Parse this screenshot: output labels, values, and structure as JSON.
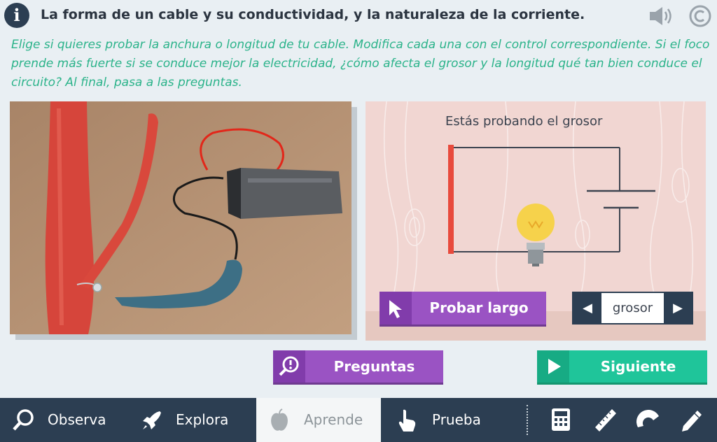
{
  "header": {
    "title": "La forma de un cable y su conductividad, y la naturaleza de la corriente.",
    "info_icon": "info-icon",
    "sound_icon": "speaker-icon",
    "copyright_icon": "copyright-icon"
  },
  "instructions": "Elige si quieres probar la anchura o longitud de tu cable. Modifica cada una con el control correspondiente. Si el foco prende más fuerte si se conduce mejor la electricidad, ¿cómo afecta el grosor y la longitud qué tan bien conduce el circuito? Al final, pasa a las preguntas.",
  "simulation": {
    "label": "Estás probando el grosor",
    "probar_button": "Probar largo",
    "selector_value": "grosor"
  },
  "actions": {
    "preguntas": "Preguntas",
    "siguiente": "Siguiente"
  },
  "nav": {
    "items": [
      {
        "label": "Observa",
        "icon": "magnifier-icon"
      },
      {
        "label": "Explora",
        "icon": "rocket-icon"
      },
      {
        "label": "Aprende",
        "icon": "apple-icon"
      },
      {
        "label": "Prueba",
        "icon": "hand-pointer-icon"
      }
    ],
    "active": "Aprende",
    "tools": [
      "calculator-icon",
      "ruler-icon",
      "protractor-icon",
      "pencil-icon"
    ]
  },
  "colors": {
    "title": "#2b3440",
    "instructions": "#2bb38a",
    "purple": "#9a53c3",
    "green": "#1fc59a",
    "navbar": "#2c3e52",
    "cable_red": "#e84a3c"
  }
}
